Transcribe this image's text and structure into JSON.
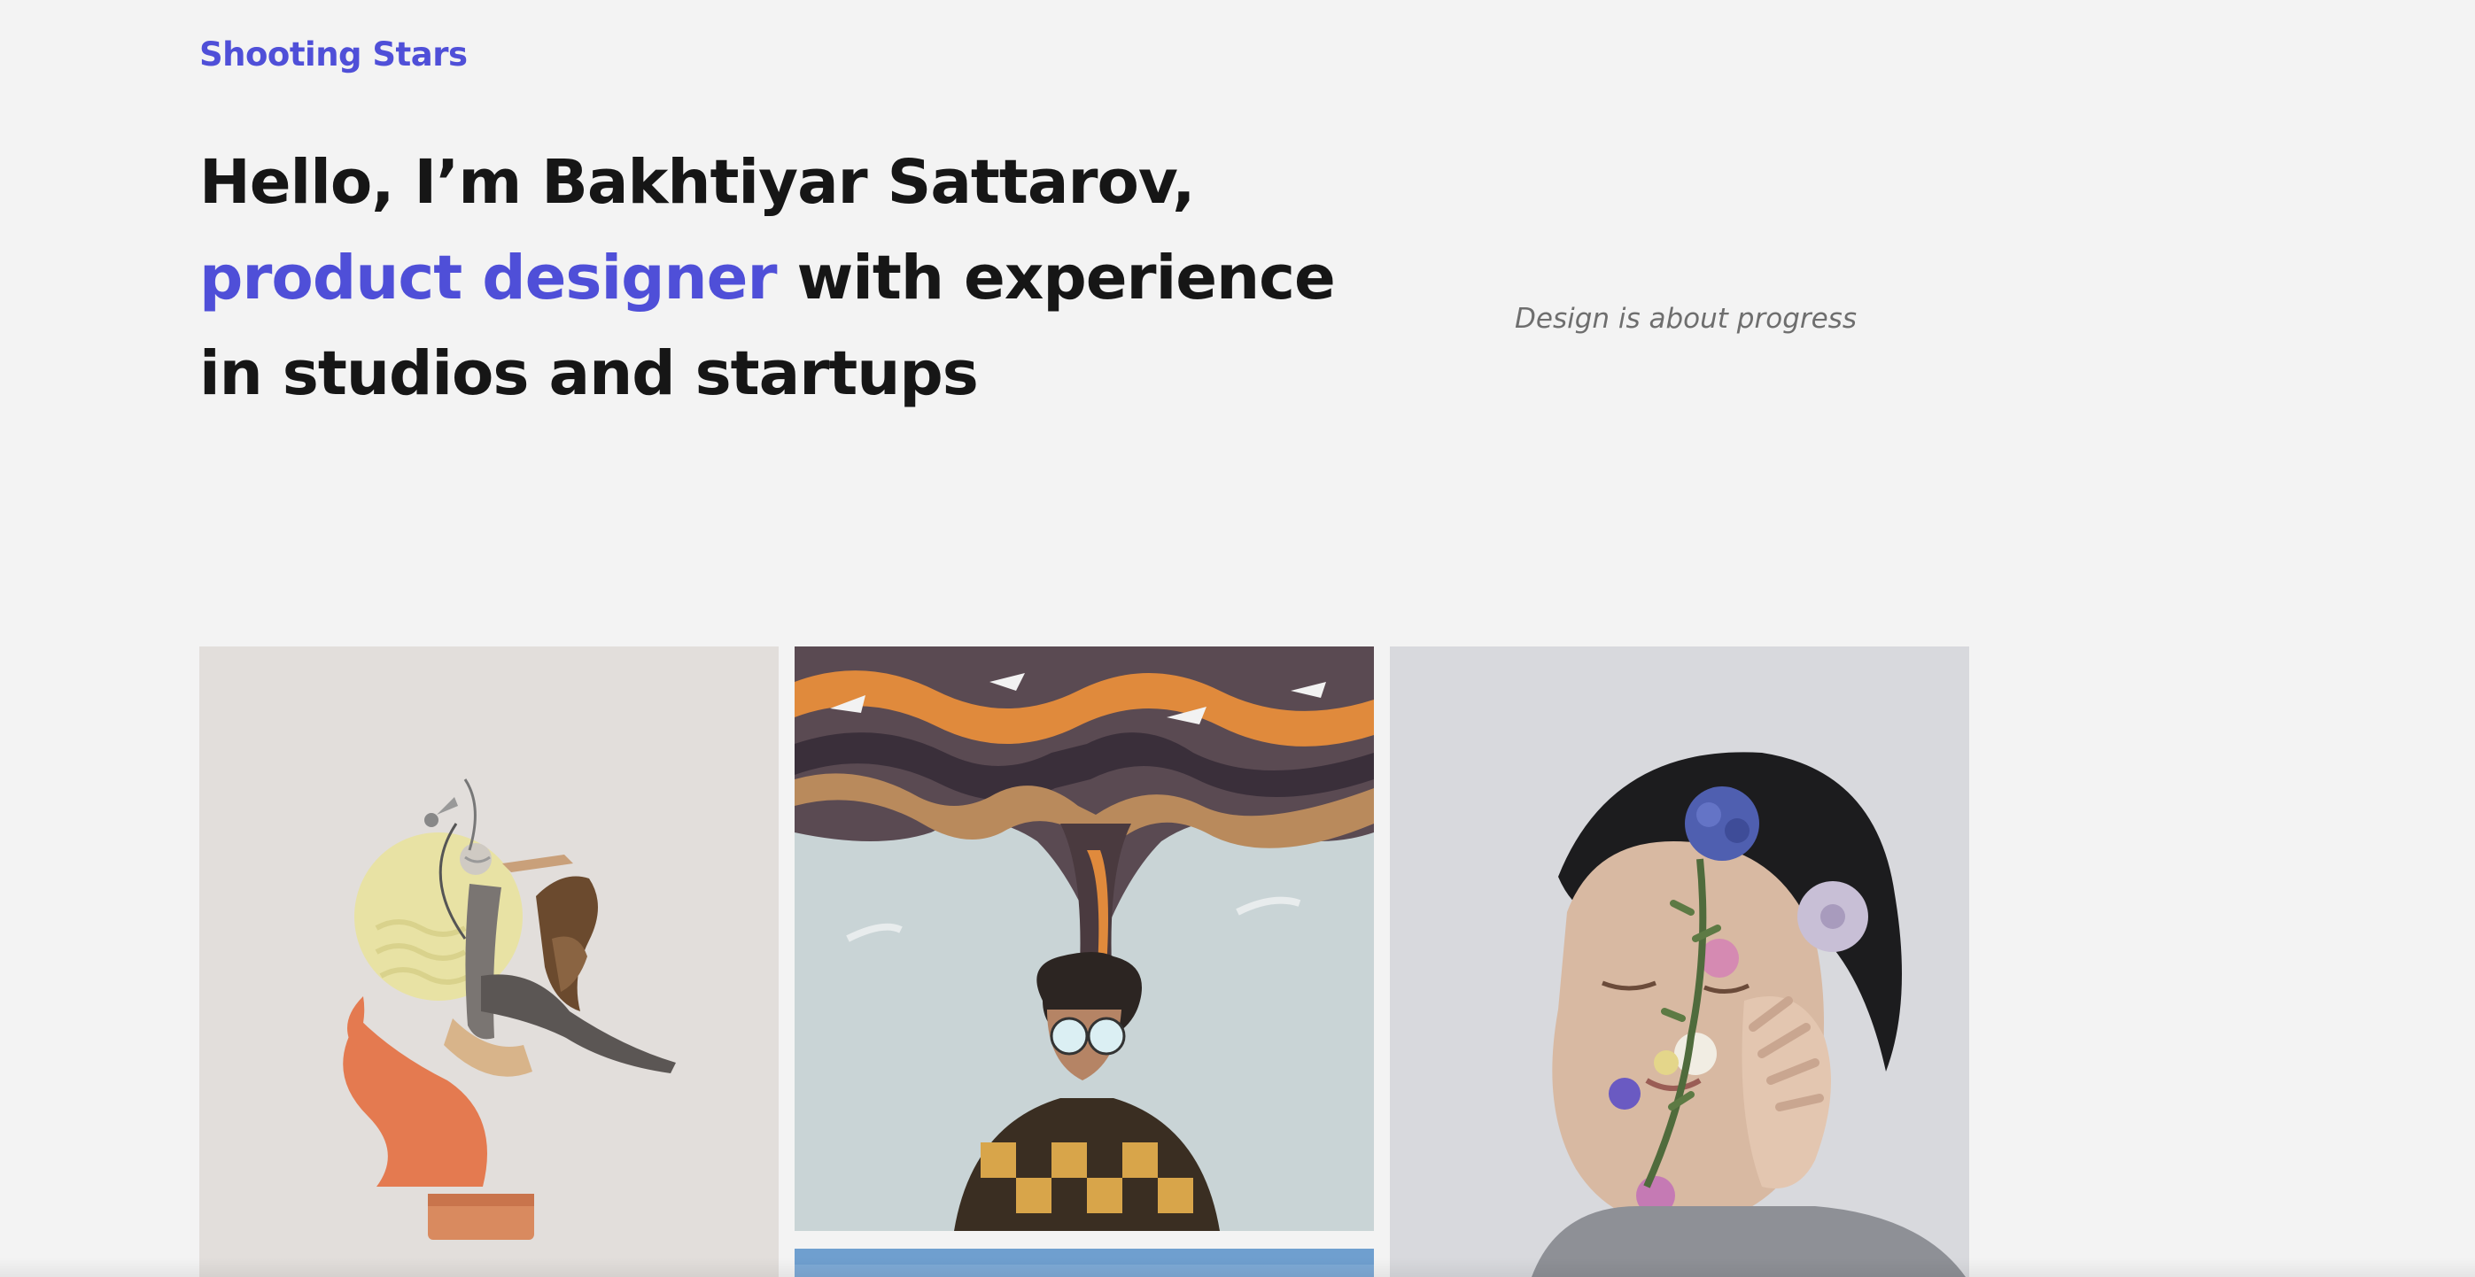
{
  "site": {
    "logo": "Shooting Stars"
  },
  "hero": {
    "line1": "Hello, I’m Bakhtiyar Sattarov,",
    "role": "product designer",
    "line2_rest": " with experience",
    "line3": "in studios and startups",
    "tagline": "Design is about progress"
  },
  "gallery": {
    "items": [
      {
        "icon": "dancer-collage-image"
      },
      {
        "icon": "smoke-head-portrait-image"
      },
      {
        "icon": "sky-landscape-image"
      },
      {
        "icon": "flower-face-portrait-image"
      }
    ]
  },
  "colors": {
    "accent": "#4f4fd8",
    "text": "#161616",
    "background": "#f3f3f3",
    "muted": "#6e6e6e"
  }
}
